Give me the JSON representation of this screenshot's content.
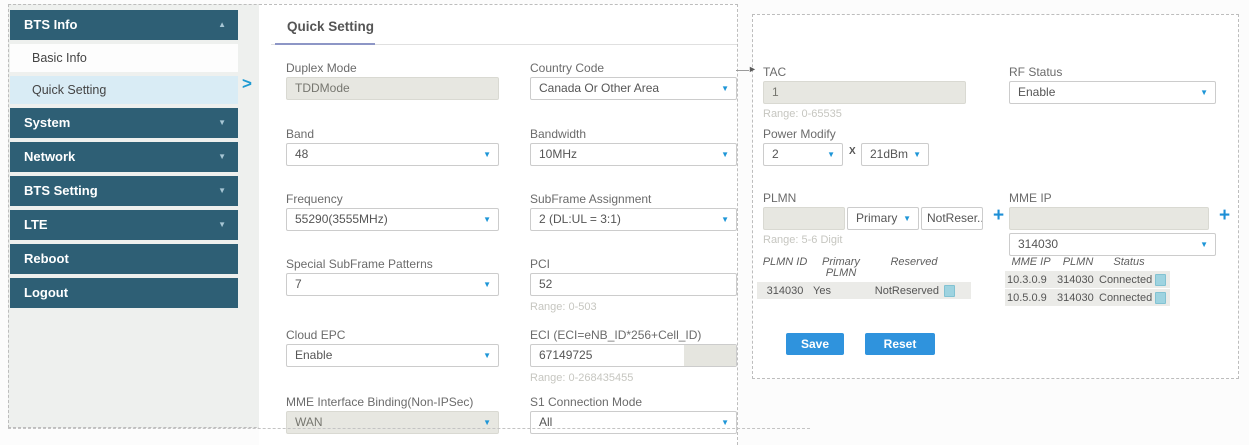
{
  "sidebar": {
    "bts_info": "BTS Info",
    "basic_info": "Basic Info",
    "quick_setting": "Quick Setting",
    "system": "System",
    "network": "Network",
    "bts_setting": "BTS Setting",
    "lte": "LTE",
    "reboot": "Reboot",
    "logout": "Logout"
  },
  "main": {
    "title": "Quick Setting",
    "fields": {
      "duplex_mode": {
        "label": "Duplex Mode",
        "value": "TDDMode"
      },
      "country_code": {
        "label": "Country Code",
        "value": "Canada Or Other Area"
      },
      "band": {
        "label": "Band",
        "value": "48"
      },
      "bandwidth": {
        "label": "Bandwidth",
        "value": "10MHz"
      },
      "frequency": {
        "label": "Frequency",
        "value": "55290(3555MHz)"
      },
      "subframe_assignment": {
        "label": "SubFrame Assignment",
        "value": "2 (DL:UL = 3:1)"
      },
      "special_subframe_patterns": {
        "label": "Special SubFrame Patterns",
        "value": "7"
      },
      "pci": {
        "label": "PCI",
        "value": "52",
        "range": "Range: 0-503"
      },
      "cloud_epc": {
        "label": "Cloud EPC",
        "value": "Enable"
      },
      "eci": {
        "label": "ECI (ECI=eNB_ID*256+Cell_ID)",
        "value": "67149725",
        "range": "Range: 0-268435455"
      },
      "mme_interface_binding": {
        "label": "MME Interface Binding(Non-IPSec)",
        "value": "WAN"
      },
      "s1_connection_mode": {
        "label": "S1 Connection Mode",
        "value": "All"
      }
    }
  },
  "right": {
    "tac": {
      "label": "TAC",
      "value": "1",
      "range": "Range: 0-65535"
    },
    "rf_status": {
      "label": "RF Status",
      "value": "Enable"
    },
    "power_modify": {
      "label": "Power Modify",
      "multiplier": "2",
      "times": "X",
      "power": "21dBm"
    },
    "plmn": {
      "label": "PLMN",
      "value": "",
      "primary": "Primary",
      "reserved": "NotReser...",
      "range": "Range: 5-6 Digit",
      "table": {
        "headers": [
          "PLMN ID",
          "Primary PLMN",
          "Reserved"
        ],
        "rows": [
          [
            "314030",
            "Yes",
            "NotReserved"
          ]
        ]
      }
    },
    "mme_ip": {
      "label": "MME IP",
      "value": "",
      "plmn_select": "314030",
      "table": {
        "headers": [
          "MME IP",
          "PLMN",
          "Status"
        ],
        "rows": [
          [
            "10.3.0.9",
            "314030",
            "Connected"
          ],
          [
            "10.5.0.9",
            "314030",
            "Connected"
          ]
        ]
      }
    },
    "save": "Save",
    "reset": "Reset"
  }
}
